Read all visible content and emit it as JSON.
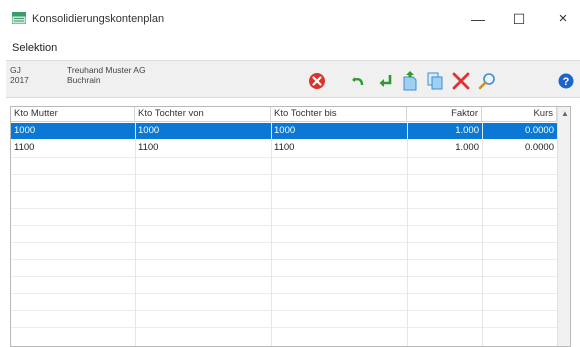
{
  "window": {
    "title": "Konsolidierungskontenplan",
    "minimize": "—",
    "maximize": "☐",
    "close": "×"
  },
  "menu": {
    "selektion": "Selektion"
  },
  "company": {
    "gj": "GJ 2017",
    "name": "Treuhand Muster AG",
    "city": "Buchrain"
  },
  "toolbar": {
    "icons": [
      "cancel-icon",
      "undo-icon",
      "enter-icon",
      "new-document-icon",
      "copy-icon",
      "delete-icon",
      "search-icon",
      "help-icon"
    ]
  },
  "table": {
    "columns": [
      "Kto Mutter",
      "Kto Tochter von",
      "Kto Tochter bis",
      "Faktor",
      "Kurs"
    ],
    "rows": [
      [
        "1000",
        "1000",
        "1000",
        "1.000",
        "0.0000"
      ],
      [
        "1100",
        "1100",
        "1100",
        "1.000",
        "0.0000"
      ]
    ],
    "selected_row": 0
  },
  "colors": {
    "selection": "#0a78d4",
    "cancel_red": "#d9332b",
    "green_arrow": "#2e9a2e",
    "delete_red": "#e23131",
    "help_blue": "#1d66c7"
  }
}
